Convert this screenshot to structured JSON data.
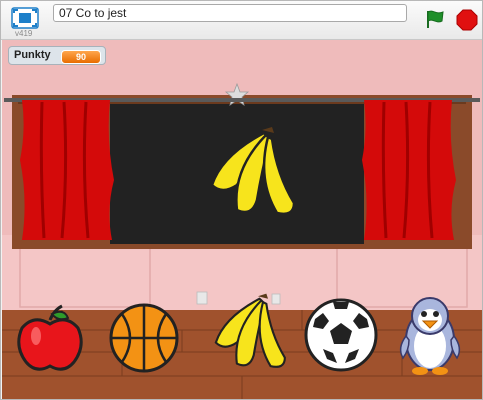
{
  "header": {
    "version": "v419",
    "project_title": "07 Co to jest"
  },
  "stage": {
    "monitor": {
      "label": "Punkty",
      "value": "90"
    },
    "board_item": "banana-sprite",
    "choices": [
      "apple-sprite",
      "basketball-sprite",
      "banana-sprite",
      "soccer-ball-sprite",
      "penguin-sprite"
    ]
  },
  "colors": {
    "wall": "#f2c0c0",
    "floor": "#a0522d",
    "curtain": "#d40a0a",
    "board": "#222222",
    "monitor_value": "#f28a1a",
    "flag": "#1f8f2a",
    "stop": "#e01010"
  }
}
